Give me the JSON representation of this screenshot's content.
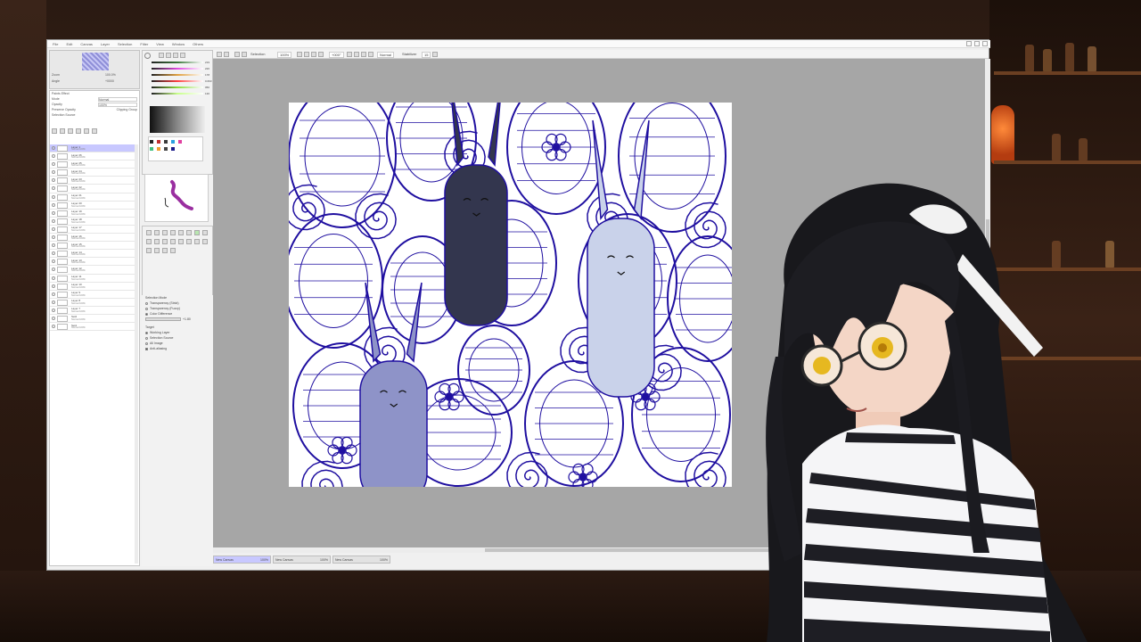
{
  "app": {
    "menus": [
      "File",
      "Edit",
      "Canvas",
      "Layer",
      "Selection",
      "Filter",
      "View",
      "Window",
      "Others"
    ]
  },
  "navigator": {
    "zoom_label": "Zoom",
    "zoom_value": "100.0%",
    "angle_label": "Angle",
    "angle_value": "+0000"
  },
  "layer_props": {
    "section": "Paints Effect",
    "mode_label": "Mode",
    "mode_value": "Normal",
    "opacity_label": "Opacity",
    "opacity_value": "100%",
    "preserve_opacity": "Preserve Opacity",
    "clipping_group": "Clipping Group",
    "selection_source": "Selection Source"
  },
  "layers": [
    {
      "name": "Layer 1",
      "mode": "Normal",
      "opacity": "100%",
      "active": true
    },
    {
      "name": "Layer 26",
      "mode": "Normal",
      "opacity": "100%"
    },
    {
      "name": "Layer 25",
      "mode": "Normal",
      "opacity": "100%"
    },
    {
      "name": "Layer 24",
      "mode": "Normal",
      "opacity": "100%"
    },
    {
      "name": "Layer 23",
      "mode": "Normal",
      "opacity": "100%"
    },
    {
      "name": "Layer 22",
      "mode": "Normal",
      "opacity": "100%"
    },
    {
      "name": "Layer 21",
      "mode": "Normal",
      "opacity": "100%"
    },
    {
      "name": "Layer 20",
      "mode": "Normal",
      "opacity": "100%"
    },
    {
      "name": "Layer 19",
      "mode": "Normal",
      "opacity": "100%"
    },
    {
      "name": "Layer 18",
      "mode": "Normal",
      "opacity": "100%"
    },
    {
      "name": "Layer 17",
      "mode": "Normal",
      "opacity": "100%"
    },
    {
      "name": "Layer 16",
      "mode": "Normal",
      "opacity": "100%"
    },
    {
      "name": "Layer 15",
      "mode": "Normal",
      "opacity": "100%"
    },
    {
      "name": "Layer 14",
      "mode": "Normal",
      "opacity": "100%"
    },
    {
      "name": "Layer 13",
      "mode": "Normal",
      "opacity": "100%"
    },
    {
      "name": "Layer 12",
      "mode": "Normal",
      "opacity": "100%"
    },
    {
      "name": "Layer 11",
      "mode": "Normal",
      "opacity": "100%"
    },
    {
      "name": "Layer 10",
      "mode": "Normal",
      "opacity": "100%"
    },
    {
      "name": "Layer 9",
      "mode": "Normal",
      "opacity": "100%"
    },
    {
      "name": "Layer 8",
      "mode": "Normal",
      "opacity": "100%"
    },
    {
      "name": "Layer 7",
      "mode": "Normal",
      "opacity": "100%"
    },
    {
      "name": "Set2",
      "mode": "Normal",
      "opacity": "100%"
    },
    {
      "name": "Set1",
      "mode": "Normal",
      "opacity": "100%"
    }
  ],
  "color": {
    "values": [
      "219",
      "226",
      "178",
      "0.693",
      "050",
      "130"
    ],
    "slider_colors": [
      "#3a7a3a",
      "#e04ae0",
      "#e0a040",
      "#ff4040",
      "#8bdc3a",
      "#c8ff8a"
    ]
  },
  "tool_options": {
    "selection_mode": "Selection Mode",
    "mode_opts": [
      "Transparency (Strict)",
      "Transparency (Fuzzy)",
      "Color Difference"
    ],
    "color_diff_value": "+1.80",
    "target": "Target",
    "target_opts": [
      "Working Layer",
      "Selection Source",
      "All Image"
    ],
    "anti_aliasing": "Anti-aliasing"
  },
  "toolbar": {
    "selection_label": "Selection",
    "zoom": "100%",
    "rotation": "+000°",
    "blend": "Normal",
    "stabilizer_label": "Stabilizer",
    "stabilizer_value": "15"
  },
  "tabs": [
    {
      "label": "New Canvas",
      "zoom": "100%",
      "active": true
    },
    {
      "label": "New Canvas",
      "zoom": "100%"
    },
    {
      "label": "New Canvas",
      "zoom": "100%"
    }
  ],
  "artwork": {
    "line_color": "#1f0fa0",
    "bunny_colors": [
      "#33364e",
      "#c9d2ea",
      "#8e93c8"
    ]
  }
}
